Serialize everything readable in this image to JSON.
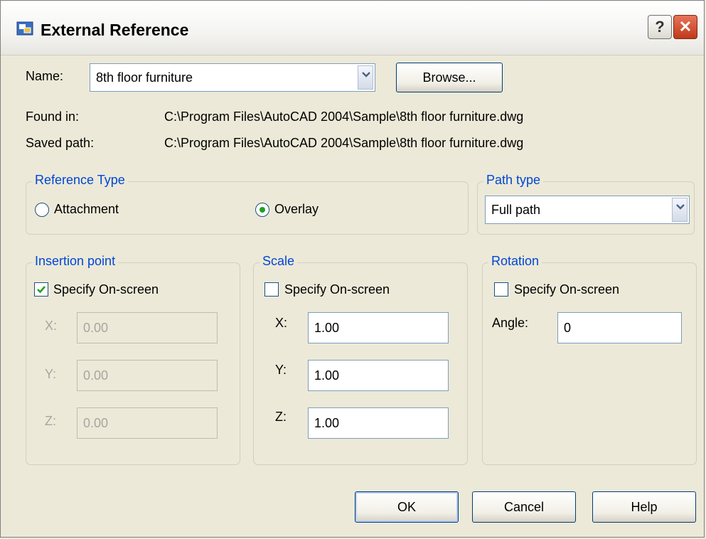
{
  "window": {
    "title": "External Reference",
    "help_button": "?",
    "close_button": "✕"
  },
  "name": {
    "label": "Name:",
    "value": "8th floor furniture",
    "browse_label": "Browse..."
  },
  "found_in": {
    "label": "Found in:",
    "value": "C:\\Program Files\\AutoCAD 2004\\Sample\\8th floor furniture.dwg"
  },
  "saved_path": {
    "label": "Saved path:",
    "value": "C:\\Program Files\\AutoCAD 2004\\Sample\\8th floor furniture.dwg"
  },
  "reference_type": {
    "title": "Reference Type",
    "attachment_label": "Attachment",
    "overlay_label": "Overlay",
    "selected": "Overlay"
  },
  "path_type": {
    "title": "Path type",
    "value": "Full path"
  },
  "insertion_point": {
    "title": "Insertion point",
    "specify_label": "Specify On-screen",
    "specify_checked": true,
    "x_label": "X:",
    "x_value": "0.00",
    "y_label": "Y:",
    "y_value": "0.00",
    "z_label": "Z:",
    "z_value": "0.00"
  },
  "scale": {
    "title": "Scale",
    "specify_label": "Specify On-screen",
    "specify_checked": false,
    "x_label": "X:",
    "x_value": "1.00",
    "y_label": "Y:",
    "y_value": "1.00",
    "z_label": "Z:",
    "z_value": "1.00"
  },
  "rotation": {
    "title": "Rotation",
    "specify_label": "Specify On-screen",
    "specify_checked": false,
    "angle_label": "Angle:",
    "angle_value": "0"
  },
  "buttons": {
    "ok": "OK",
    "cancel": "Cancel",
    "help": "Help"
  }
}
